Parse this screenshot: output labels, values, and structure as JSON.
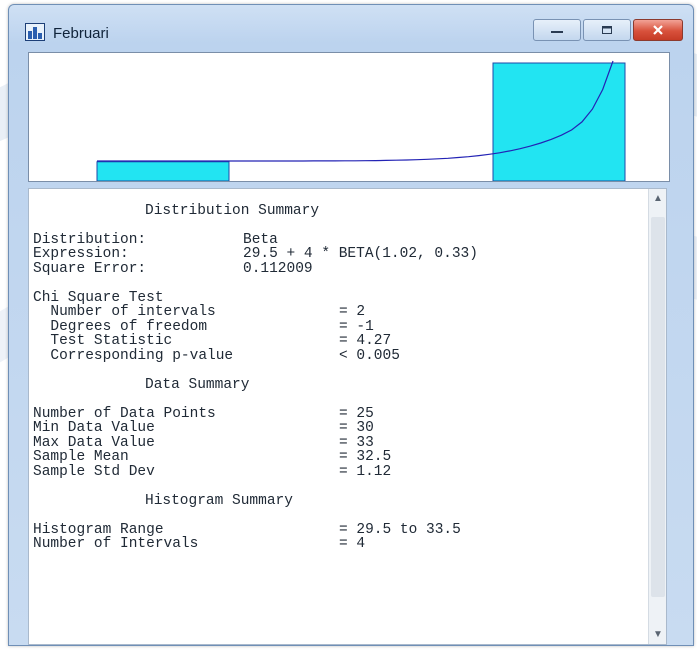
{
  "window": {
    "title": "Februari",
    "icon": "fit-app-icon"
  },
  "caption_buttons": {
    "minimize": "minimize-icon",
    "restore": "restore-icon",
    "close": "close-icon"
  },
  "colors": {
    "bar_fill": "#22e4f2",
    "bar_stroke": "#1c4aa8",
    "curve": "#2323b5"
  },
  "chart_data": {
    "type": "bar",
    "categories": [
      "29.5-30.5",
      "30.5-31.5",
      "31.5-32.5",
      "32.5-33.5"
    ],
    "values": [
      0.14,
      0,
      0,
      0.86
    ],
    "title": "",
    "xlabel": "",
    "ylabel": "",
    "fitted_curve": {
      "name": "Beta",
      "shape": "increasing-exponential"
    },
    "grid": false
  },
  "summary": {
    "distribution_heading": "Distribution Summary",
    "distribution_label": "Distribution:",
    "distribution_value": "Beta",
    "expression_label": "Expression:",
    "expression_value": "29.5 + 4 * BETA(1.02, 0.33)",
    "square_error_label": "Square Error:",
    "square_error_value": "0.112009",
    "chi_heading": "Chi Square Test",
    "intervals_label": "  Number of intervals",
    "intervals_value": "= 2",
    "dof_label": "  Degrees of freedom",
    "dof_value": "= -1",
    "test_stat_label": "  Test Statistic",
    "test_stat_value": "= 4.27",
    "pvalue_label": "  Corresponding p-value",
    "pvalue_value": "< 0.005",
    "data_heading": "Data Summary",
    "num_points_label": "Number of Data Points",
    "num_points_value": "= 25",
    "min_label": "Min Data Value",
    "min_value": "= 30",
    "max_label": "Max Data Value",
    "max_value": "= 33",
    "mean_label": "Sample Mean",
    "mean_value": "= 32.5",
    "std_label": "Sample Std Dev",
    "std_value": "= 1.12",
    "hist_heading": "Histogram Summary",
    "hist_range_label": "Histogram Range",
    "hist_range_value": "= 29.5 to 33.5",
    "hist_intervals_label": "Number of Intervals",
    "hist_intervals_value": "= 4"
  }
}
